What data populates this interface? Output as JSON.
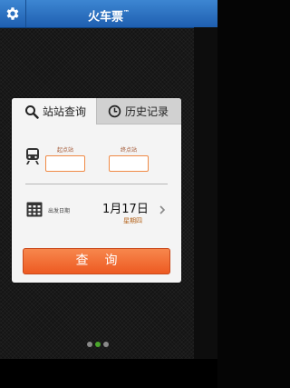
{
  "header": {
    "title": "火车票",
    "title_mark": "™"
  },
  "tabs": [
    {
      "label": "站站查询",
      "icon": "search-icon"
    },
    {
      "label": "历史记录",
      "icon": "clock-icon"
    }
  ],
  "form": {
    "from_label": "起点站",
    "to_label": "终点站",
    "from_value": "",
    "to_value": "",
    "date_label": "出发日期",
    "date_value": "1月17日",
    "weekday": "星期四"
  },
  "query_button": "查询",
  "pager": {
    "count": 3,
    "active_index": 1
  },
  "colors": {
    "title_bar": "#2f73c4",
    "accent": "#f07030",
    "input_border": "#f08a45",
    "active_dot": "#4aa62b"
  }
}
